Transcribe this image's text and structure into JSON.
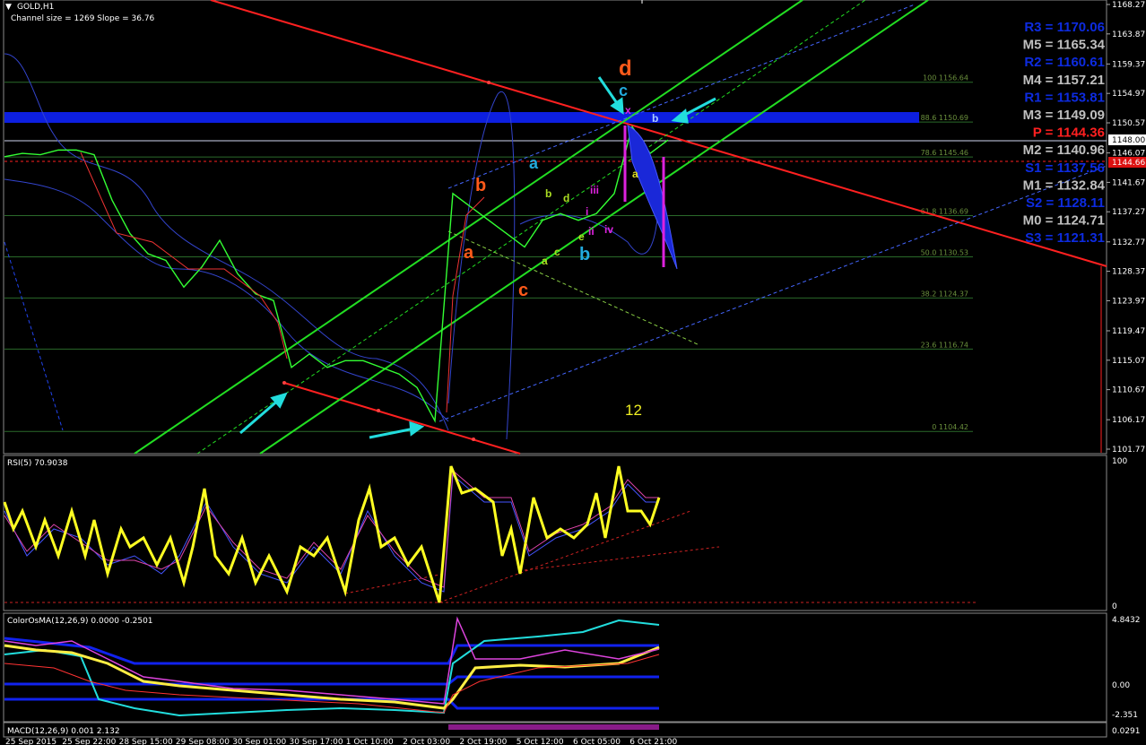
{
  "chart_title": "GOLD,H1",
  "channel_info": "Channel size = 1269 Slope = 36.76",
  "price_axis": {
    "ticks": [
      "1168.27",
      "1163.87",
      "1159.37",
      "1154.97",
      "1150.57",
      "1146.07",
      "1141.67",
      "1137.27",
      "1132.77",
      "1128.37",
      "1123.97",
      "1119.47",
      "1115.07",
      "1110.67",
      "1106.17",
      "1101.77"
    ],
    "current_bid": "1148.00",
    "current_ask": "1144.66"
  },
  "pivots": [
    {
      "label": "R3 = 1170.06",
      "color": "#0d2be0"
    },
    {
      "label": "M5 = 1165.34",
      "color": "#bfbfbf"
    },
    {
      "label": "R2 = 1160.61",
      "color": "#0d2be0"
    },
    {
      "label": "M4 = 1157.21",
      "color": "#bfbfbf"
    },
    {
      "label": "R1 = 1153.81",
      "color": "#0d2be0"
    },
    {
      "label": "M3 = 1149.09",
      "color": "#bfbfbf"
    },
    {
      "label": "P  = 1144.36",
      "color": "#ff2020"
    },
    {
      "label": "M2 = 1140.96",
      "color": "#bfbfbf"
    },
    {
      "label": "S1 = 1137.56",
      "color": "#0d2be0"
    },
    {
      "label": "M1 = 1132.84",
      "color": "#bfbfbf"
    },
    {
      "label": "S2 = 1128.11",
      "color": "#0d2be0"
    },
    {
      "label": "M0 = 1124.71",
      "color": "#bfbfbf"
    },
    {
      "label": "S3 = 1121.31",
      "color": "#0d2be0"
    }
  ],
  "fib_levels": [
    {
      "label": "100 1156.64",
      "price": 1156.64
    },
    {
      "label": "88.6 1150.69",
      "price": 1150.69
    },
    {
      "label": "78.6 1145.46",
      "price": 1145.46
    },
    {
      "label": "61.8 1136.69",
      "price": 1136.69
    },
    {
      "label": "50.0 1130.53",
      "price": 1130.53
    },
    {
      "label": "38.2 1124.37",
      "price": 1124.37
    },
    {
      "label": "23.6 1116.74",
      "price": 1116.74
    },
    {
      "label": "0 1104.42",
      "price": 1104.42
    }
  ],
  "wave_labels": {
    "d_major": "d",
    "c_major": "c",
    "b_orange": "b",
    "a_orange": "a",
    "c_orange": "c",
    "a_blue": "a",
    "b_blue": "b",
    "c_small": "c",
    "b_small": "b",
    "d_small": "d",
    "e_small": "e",
    "a_small": "a",
    "a_small2": "a",
    "b_small2": "b",
    "x_small": "x",
    "i": "i",
    "ii": "ii",
    "iii": "iii",
    "iv": "iv",
    "count": "12"
  },
  "rsi": {
    "title": "RSI(5) 70.9038",
    "max_label": "100",
    "min_label": "0"
  },
  "osma": {
    "title": "ColorOsMA(12,26,9) 0.0000 -0.2501",
    "labels": [
      "4.8432",
      "0.00",
      "-2.351"
    ]
  },
  "macd": {
    "title": "MACD(12,26,9) 0.001 2.132",
    "labels": [
      "0.0291"
    ]
  },
  "time_axis": [
    "25 Sep 2015",
    "25 Sep 22:00",
    "28 Sep 15:00",
    "29 Sep 08:00",
    "30 Sep 01:00",
    "30 Sep 17:00",
    "1 Oct 10:00",
    "2 Oct 03:00",
    "2 Oct 19:00",
    "5 Oct 12:00",
    "6 Oct 05:00",
    "6 Oct 21:00"
  ],
  "chart_data": {
    "type": "line",
    "title": "GOLD,H1",
    "ylim": [
      1101.77,
      1168.27
    ],
    "x": [
      0,
      20,
      40,
      60,
      80,
      100,
      120,
      140,
      160,
      180,
      200,
      220,
      240,
      260,
      280,
      300,
      320,
      340,
      360,
      380,
      400,
      420,
      440,
      460,
      480,
      500,
      520,
      540,
      560,
      580,
      600,
      620,
      640,
      660,
      680,
      700,
      720,
      740
    ],
    "values": [
      1145.5,
      1146.0,
      1145.8,
      1146.5,
      1146.5,
      1145.8,
      1139,
      1134,
      1131,
      1130,
      1126,
      1129,
      1133,
      1128,
      1125,
      1124,
      1114,
      1116,
      1114,
      1115,
      1115,
      1114,
      1113,
      1111,
      1106,
      1140,
      1138,
      1136,
      1134,
      1132,
      1136,
      1137,
      1136,
      1137,
      1140,
      1150,
      1146,
      1148
    ]
  }
}
